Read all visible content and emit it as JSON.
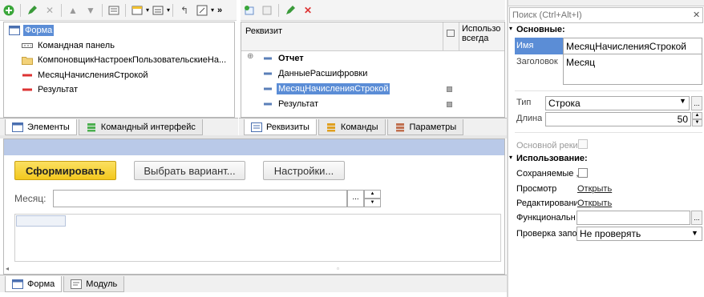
{
  "left_toolbar": {
    "more": "»"
  },
  "elements_tree": {
    "items": [
      {
        "label": "Форма",
        "selected": true
      },
      {
        "label": "Командная панель"
      },
      {
        "label": "КомпоновщикНастроекПользовательскиеНа..."
      },
      {
        "label": "МесяцНачисленияСтрокой"
      },
      {
        "label": "Результат"
      }
    ]
  },
  "left_tabs": [
    {
      "label": "Элементы"
    },
    {
      "label": "Командный интерфейс"
    }
  ],
  "attributes": {
    "col_requisite": "Реквизит",
    "col_use_always": "Использо всегда",
    "items": [
      {
        "label": "Отчет",
        "bold": true
      },
      {
        "label": "ДанныеРасшифровки"
      },
      {
        "label": "МесяцНачисленияСтрокой",
        "selected": true
      },
      {
        "label": "Результат"
      }
    ],
    "expand": "⊕"
  },
  "middle_tabs": [
    {
      "label": "Реквизиты"
    },
    {
      "label": "Команды"
    },
    {
      "label": "Параметры"
    }
  ],
  "preview": {
    "generate_button": "Сформировать",
    "variant_button": "Выбрать вариант...",
    "settings_button": "Настройки...",
    "month_label": "Месяц:",
    "ellipsis": "..."
  },
  "bottom_tabs": [
    {
      "label": "Форма"
    },
    {
      "label": "Модуль"
    }
  ],
  "properties": {
    "search_placeholder": "Поиск (Ctrl+Alt+I)",
    "section_main": "Основные:",
    "name_label": "Имя",
    "name_value": "МесяцНачисленияСтрокой",
    "title_label": "Заголовок",
    "title_value": "Месяц",
    "type_label": "Тип",
    "type_value": "Строка",
    "length_label": "Длина",
    "length_value": "50",
    "main_req_label": "Основной реки",
    "section_use": "Использование:",
    "saved_label": "Сохраняемые ,",
    "view_label": "Просмотр",
    "view_link": "Открыть",
    "edit_label": "Редактирование",
    "edit_link": "Открыть",
    "func_label": "Функциональн",
    "check_label": "Проверка запо",
    "check_value": "Не проверять",
    "clear": "✕",
    "ellipsis": "..."
  },
  "colors": {
    "accent_yellow": "#f7d23a",
    "selection": "#5b8dd6",
    "preview_bar": "#b9c9e8",
    "red": "#d33"
  }
}
